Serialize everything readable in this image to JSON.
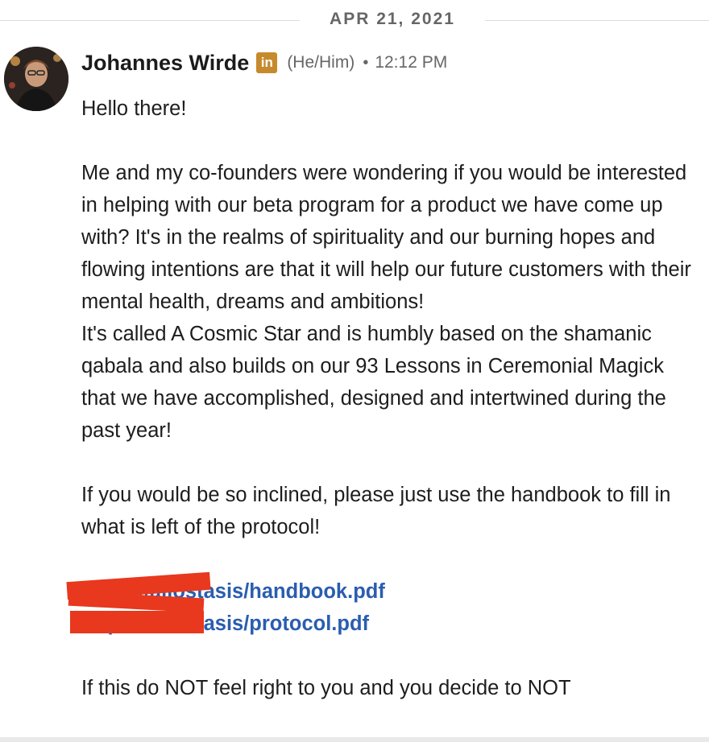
{
  "date_divider": "APR 21, 2021",
  "message": {
    "author": "Johannes Wirde",
    "badge_icon_text": "in",
    "pronouns": "(He/Him)",
    "separator": "•",
    "time": "12:12 PM",
    "greeting": "Hello there!",
    "para1": "Me and my co-founders were wondering if you would be interested in helping with our beta program for a product we have come up with? It's in the realms of spirituality and our burning hopes and flowing intentions are that it will help our future customers with their mental health, dreams and ambitions!",
    "para2": "It's called A Cosmic Star and is humbly based on the shamanic qabala and also builds on our 93 Lessons in Ceremonial Magick that we have accomplished, designed and intertwined during the past year!",
    "para3": "If you would be so inclined, please just use the handbook to fill in what is left of the protocol!",
    "link1": "https://allostasis/handbook.pdf",
    "link2": "https://allostasis/protocol.pdf",
    "para4": "If this do NOT feel right to you and you decide to NOT"
  },
  "colors": {
    "link": "#2a5db0",
    "redaction": "#e8381d",
    "badge": "#c68a2c"
  }
}
